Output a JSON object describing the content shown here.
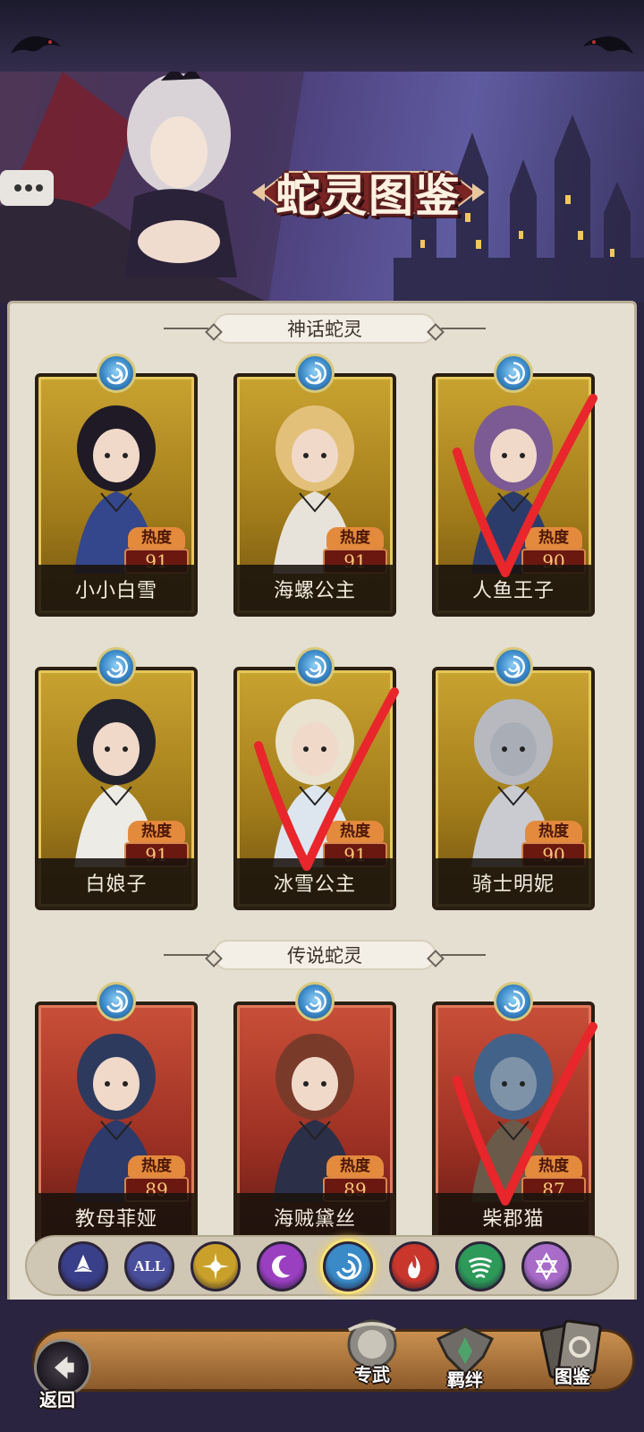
{
  "header": {
    "title": "蛇灵图鉴"
  },
  "sections": [
    {
      "label": "神话蛇灵"
    },
    {
      "label": "传说蛇灵"
    }
  ],
  "heat_label": "热度",
  "cards": [
    {
      "name": "小小白雪",
      "heat": "91",
      "rarity": "gold",
      "checked": false
    },
    {
      "name": "海螺公主",
      "heat": "91",
      "rarity": "gold",
      "checked": false
    },
    {
      "name": "人鱼王子",
      "heat": "90",
      "rarity": "gold",
      "checked": true
    },
    {
      "name": "白娘子",
      "heat": "91",
      "rarity": "gold",
      "checked": false
    },
    {
      "name": "冰雪公主",
      "heat": "91",
      "rarity": "gold",
      "checked": true
    },
    {
      "name": "骑士明妮",
      "heat": "90",
      "rarity": "gold",
      "checked": false
    },
    {
      "name": "教母菲娅",
      "heat": "89",
      "rarity": "red",
      "checked": false
    },
    {
      "name": "海贼黛丝",
      "heat": "89",
      "rarity": "red",
      "checked": false
    },
    {
      "name": "柴郡猫",
      "heat": "87",
      "rarity": "red",
      "checked": true
    }
  ],
  "filters": [
    {
      "icon": "arrow-star-icon",
      "label": "",
      "color": "#3a3f8a"
    },
    {
      "icon": "all-icon",
      "label": "ALL",
      "color": "#4a4f9c"
    },
    {
      "icon": "sun-icon",
      "label": "",
      "color": "#c9a12a"
    },
    {
      "icon": "moon-icon",
      "label": "",
      "color": "#9a3fc0"
    },
    {
      "icon": "water-swirl-icon",
      "label": "",
      "color": "#3a8ac8",
      "selected": true
    },
    {
      "icon": "fire-icon",
      "label": "",
      "color": "#c8362c"
    },
    {
      "icon": "wind-icon",
      "label": "",
      "color": "#2e9a5a"
    },
    {
      "icon": "hexagram-icon",
      "label": "",
      "color": "#a86bc8"
    }
  ],
  "nav": {
    "back": "返回",
    "items": [
      {
        "label": "专武",
        "icon": "weapon-orb-icon"
      },
      {
        "label": "羁绊",
        "icon": "bond-crest-icon"
      },
      {
        "label": "图鉴",
        "icon": "card-book-icon"
      }
    ]
  },
  "colors": {
    "mythic_frame": "#c9a330",
    "legend_frame": "#c94f38",
    "check_mark": "#e8262b",
    "selected_glow": "#f3d45a"
  }
}
